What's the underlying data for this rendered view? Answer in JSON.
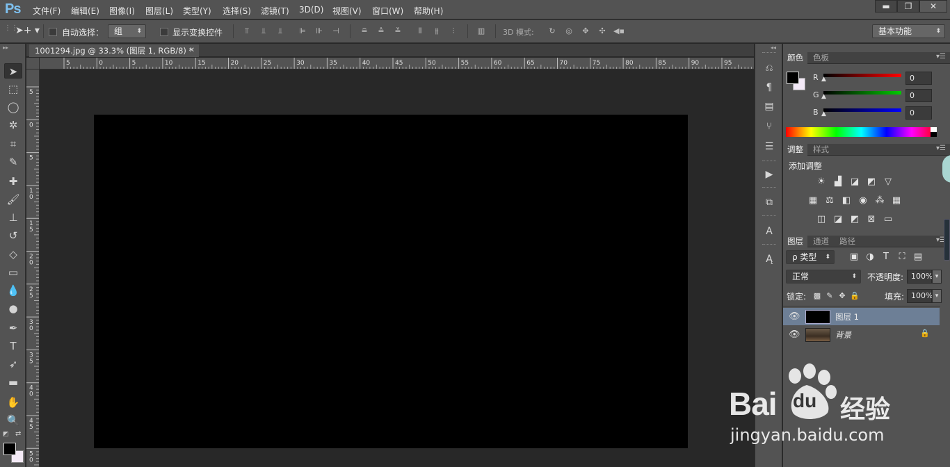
{
  "app": {
    "logo": "Ps"
  },
  "menu": [
    "文件(F)",
    "编辑(E)",
    "图像(I)",
    "图层(L)",
    "类型(Y)",
    "选择(S)",
    "滤镜(T)",
    "3D(D)",
    "视图(V)",
    "窗口(W)",
    "帮助(H)"
  ],
  "window_controls": {
    "minimize": "▬",
    "restore": "❐",
    "close": "✕"
  },
  "options": {
    "auto_select_label": "自动选择：",
    "auto_select_value": "组",
    "show_transform_label": "显示变换控件",
    "mode_3d_label": "3D 模式:",
    "workspace": "基本功能"
  },
  "document_tab": {
    "title": "1001294.jpg @ 33.3% (图层 1, RGB/8) *",
    "close": "✕"
  },
  "ruler": {
    "h_labels": [
      "5",
      "0",
      "5",
      "10",
      "15",
      "20",
      "25",
      "30",
      "35",
      "40",
      "45",
      "50",
      "55",
      "60",
      "65",
      "70",
      "75",
      "80",
      "85",
      "90",
      "95"
    ],
    "v_labels": [
      "5",
      "0",
      "5",
      "10",
      "15",
      "20",
      "25",
      "30",
      "35",
      "40",
      "45",
      "50"
    ]
  },
  "panels": {
    "color": {
      "tabs": [
        "颜色",
        "色板"
      ],
      "r_label": "R",
      "g_label": "G",
      "b_label": "B",
      "r_value": "0",
      "g_value": "0",
      "b_value": "0"
    },
    "adjustments": {
      "tabs": [
        "调整",
        "样式"
      ],
      "title": "添加调整"
    },
    "layers": {
      "tabs": [
        "图层",
        "通道",
        "路径"
      ],
      "filter_type": "ρ 类型",
      "blend_mode": "正常",
      "opacity_label": "不透明度:",
      "opacity_value": "100%",
      "lock_label": "锁定:",
      "fill_label": "填充:",
      "fill_value": "100%",
      "items": [
        {
          "name": "图层 1",
          "selected": true
        },
        {
          "name": "背景",
          "selected": false
        }
      ]
    }
  },
  "watermark": {
    "brand_a": "Bai",
    "brand_b": "du",
    "suffix": "经验",
    "url": "jingyan.baidu.com"
  },
  "colors": {
    "foreground": "#000000",
    "background": "#ffffff",
    "accent_selected": "#6d7f96"
  }
}
